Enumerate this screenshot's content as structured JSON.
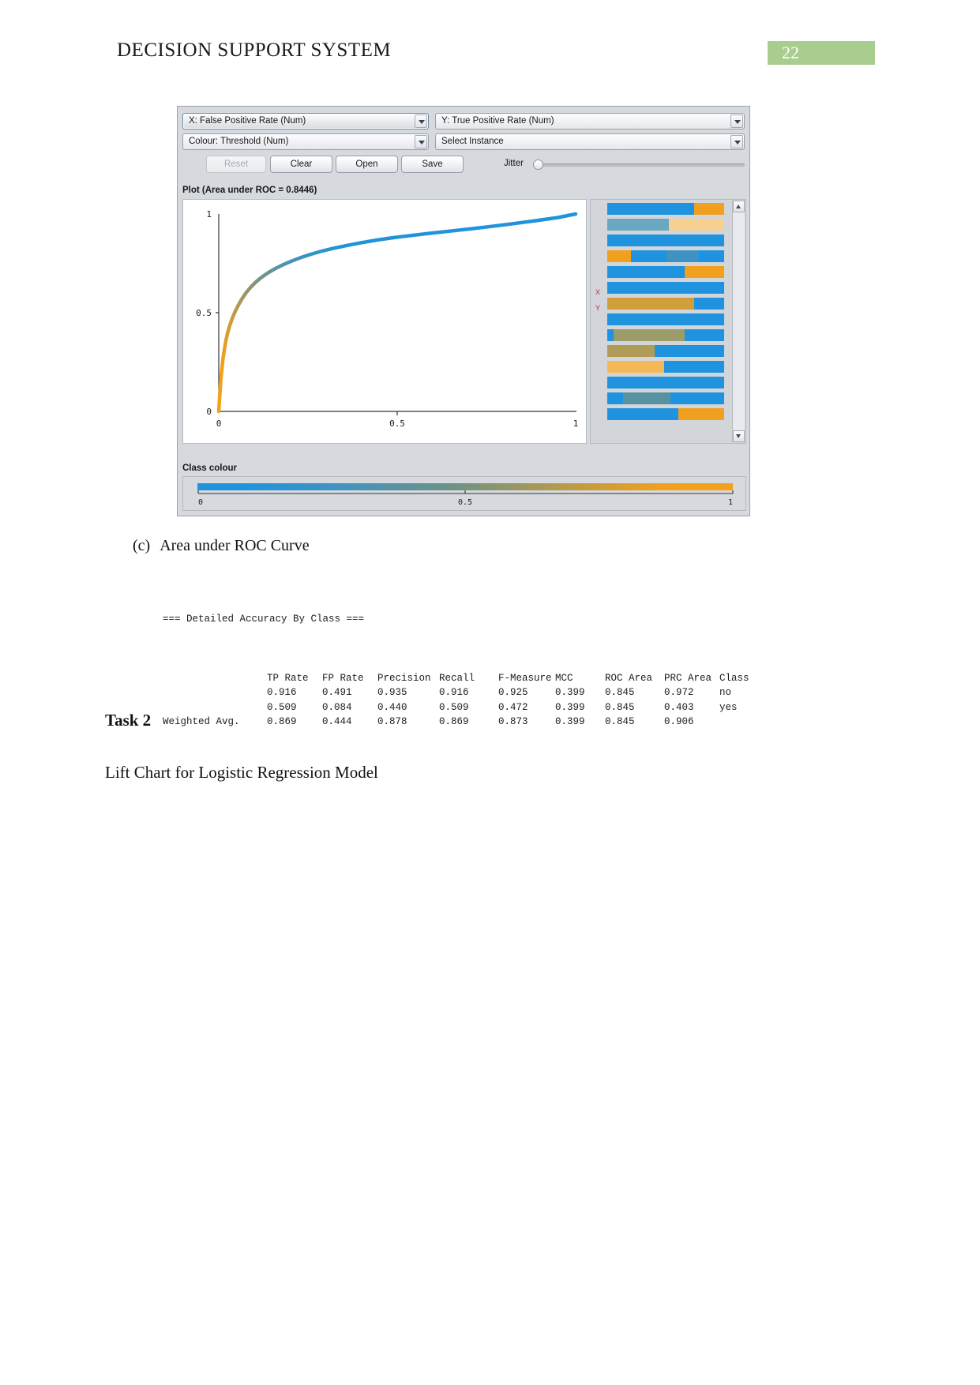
{
  "page": {
    "header_title": "DECISION SUPPORT SYSTEM",
    "page_number": "22"
  },
  "weka": {
    "selectors": {
      "x_axis": "X: False Positive Rate (Num)",
      "y_axis": "Y: True Positive Rate (Num)",
      "colour": "Colour: Threshold (Num)",
      "instance": "Select Instance"
    },
    "buttons": {
      "reset": "Reset",
      "clear": "Clear",
      "open": "Open",
      "save": "Save"
    },
    "jitter": {
      "label": "Jitter",
      "value": 0
    },
    "plot_title": "Plot (Area under ROC = 0.8446)",
    "instance_markers": {
      "x": "X",
      "y": "Y"
    },
    "class_colour": {
      "label": "Class colour",
      "ticks": [
        "0",
        "0.5",
        "1"
      ],
      "start_color": "#1f93dd",
      "end_color": "#f5a01c"
    }
  },
  "chart_data": {
    "type": "line",
    "title": "Plot (Area under ROC = 0.8446)",
    "xlabel": "False Positive Rate",
    "ylabel": "True Positive Rate",
    "xlim": [
      0,
      1
    ],
    "ylim": [
      0,
      1
    ],
    "xticks": [
      "0",
      "0.5",
      "1"
    ],
    "yticks": [
      "0",
      "0.5",
      "1"
    ],
    "grid": false,
    "legend": "none",
    "area_under_roc": 0.8446,
    "series": [
      {
        "name": "ROC curve",
        "colormap": "threshold (blue=0 -> orange=1)",
        "x": [
          0.0,
          0.002,
          0.004,
          0.006,
          0.009,
          0.012,
          0.016,
          0.02,
          0.025,
          0.031,
          0.038,
          0.046,
          0.055,
          0.065,
          0.076,
          0.089,
          0.103,
          0.119,
          0.137,
          0.157,
          0.179,
          0.203,
          0.229,
          0.258,
          0.289,
          0.323,
          0.36,
          0.4,
          0.443,
          0.489,
          0.538,
          0.59,
          0.645,
          0.702,
          0.762,
          0.824,
          0.888,
          0.95,
          1.0
        ],
        "y": [
          0.0,
          0.055,
          0.11,
          0.165,
          0.218,
          0.268,
          0.315,
          0.358,
          0.398,
          0.436,
          0.472,
          0.506,
          0.539,
          0.57,
          0.6,
          0.628,
          0.654,
          0.678,
          0.701,
          0.722,
          0.742,
          0.761,
          0.779,
          0.796,
          0.812,
          0.827,
          0.841,
          0.855,
          0.868,
          0.88,
          0.891,
          0.902,
          0.913,
          0.924,
          0.937,
          0.951,
          0.966,
          0.982,
          1.0
        ]
      }
    ]
  },
  "figure_caption": {
    "number": "(c)",
    "text": "Area under ROC Curve"
  },
  "accuracy_output": {
    "title": "=== Detailed Accuracy By Class ===",
    "columns": [
      "TP Rate",
      "FP Rate",
      "Precision",
      "Recall",
      "F-Measure",
      "MCC",
      "ROC Area",
      "PRC Area",
      "Class"
    ],
    "rows": [
      {
        "label": "",
        "values": [
          "0.916",
          "0.491",
          "0.935",
          "0.916",
          "0.925",
          "0.399",
          "0.845",
          "0.972",
          "no"
        ]
      },
      {
        "label": "",
        "values": [
          "0.509",
          "0.084",
          "0.440",
          "0.509",
          "0.472",
          "0.399",
          "0.845",
          "0.403",
          "yes"
        ]
      },
      {
        "label": "Weighted Avg.",
        "values": [
          "0.869",
          "0.444",
          "0.878",
          "0.869",
          "0.873",
          "0.399",
          "0.845",
          "0.906",
          ""
        ]
      }
    ]
  },
  "body": {
    "task_heading": "Task 2",
    "task_text": "Lift Chart for Logistic Regression Model"
  }
}
